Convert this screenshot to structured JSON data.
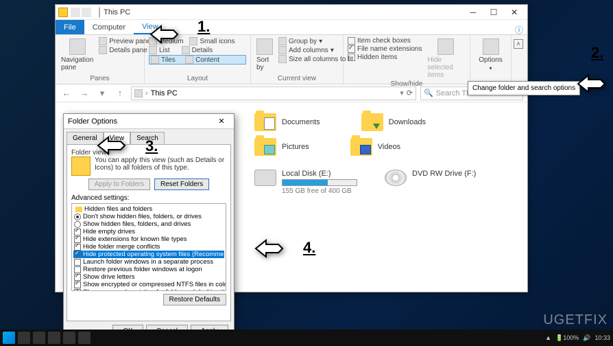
{
  "window": {
    "title": "This PC"
  },
  "ribbon_tabs": {
    "file": "File",
    "computer": "Computer",
    "view": "View"
  },
  "ribbon": {
    "panes": {
      "label": "Panes",
      "navigation": "Navigation\npane",
      "preview": "Preview pane",
      "details": "Details pane"
    },
    "layout": {
      "label": "Layout",
      "medium": "Medium",
      "small": "Small icons",
      "list": "List",
      "details_v": "Details",
      "tiles": "Tiles",
      "content": "Content"
    },
    "current_view": {
      "label": "Current view",
      "sort": "Sort\nby",
      "group": "Group by",
      "add_cols": "Add columns",
      "size_cols": "Size all columns to fit"
    },
    "show_hide": {
      "label": "Show/hide",
      "item_chk": "Item check boxes",
      "file_ext": "File name extensions",
      "hidden": "Hidden items",
      "hide_sel": "Hide selected\nitems"
    },
    "options": {
      "label": "Options"
    }
  },
  "tooltip": {
    "options": "Change folder and search options"
  },
  "address": {
    "path": "This PC",
    "refresh": "⟳"
  },
  "search": {
    "placeholder": "Search This PC"
  },
  "folders": {
    "documents": "Documents",
    "downloads": "Downloads",
    "pictures": "Pictures",
    "videos": "Videos"
  },
  "drives": {
    "local": {
      "name": "Local Disk (E:)",
      "free": "155 GB free of 400 GB",
      "fill_pct": 61
    },
    "dvd": {
      "name": "DVD RW Drive (F:)"
    }
  },
  "dialog": {
    "title": "Folder Options",
    "tabs": {
      "general": "General",
      "view": "View",
      "search": "Search"
    },
    "folder_views": {
      "label": "Folder views",
      "text": "You can apply this view (such as Details or Icons) to all folders of this type.",
      "apply": "Apply to Folders",
      "reset": "Reset Folders"
    },
    "advanced": {
      "label": "Advanced settings:",
      "items": [
        {
          "t": "folder",
          "label": "Hidden files and folders"
        },
        {
          "t": "radio",
          "on": true,
          "label": "Don't show hidden files, folders, or drives"
        },
        {
          "t": "radio",
          "on": false,
          "label": "Show hidden files, folders, and drives"
        },
        {
          "t": "check",
          "on": true,
          "label": "Hide empty drives"
        },
        {
          "t": "check",
          "on": true,
          "label": "Hide extensions for known file types"
        },
        {
          "t": "check",
          "on": true,
          "label": "Hide folder merge conflicts"
        },
        {
          "t": "check",
          "on": true,
          "sel": true,
          "label": "Hide protected operating system files (Recommended)"
        },
        {
          "t": "check",
          "on": false,
          "label": "Launch folder windows in a separate process"
        },
        {
          "t": "check",
          "on": false,
          "label": "Restore previous folder windows at logon"
        },
        {
          "t": "check",
          "on": true,
          "label": "Show drive letters"
        },
        {
          "t": "check",
          "on": true,
          "label": "Show encrypted or compressed NTFS files in color"
        },
        {
          "t": "check",
          "on": true,
          "label": "Show pop-up description for folder and desktop items"
        }
      ],
      "restore": "Restore Defaults"
    },
    "buttons": {
      "ok": "OK",
      "cancel": "Cancel",
      "apply": "Apply"
    }
  },
  "steps": {
    "s1": "1.",
    "s2": "2.",
    "s3": "3.",
    "s4": "4."
  },
  "tray": {
    "time": "10:33"
  },
  "watermark": "UGETFIX"
}
